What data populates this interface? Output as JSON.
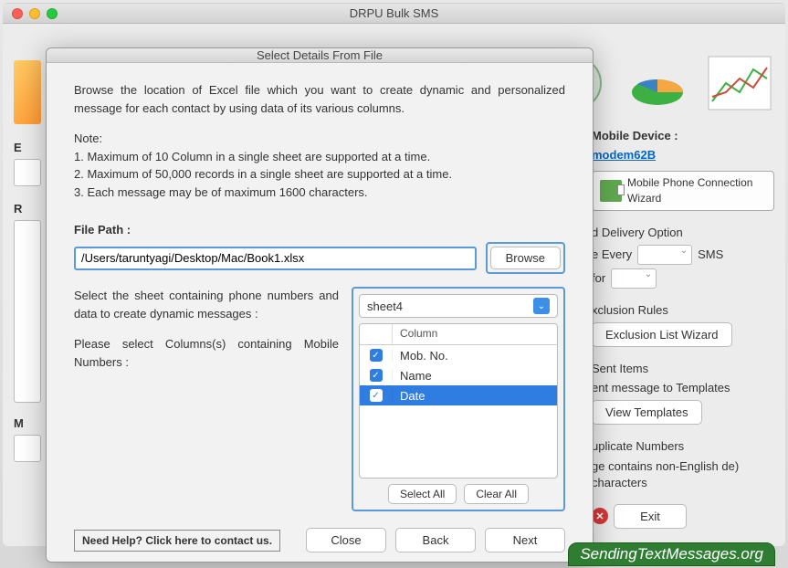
{
  "window": {
    "title": "DRPU Bulk SMS"
  },
  "modal": {
    "title": "Select Details From File",
    "intro": "Browse the location of Excel file which you want to create dynamic and personalized message for each contact by using data of its various columns.",
    "note_label": "Note:",
    "note1": "1. Maximum of 10 Column in a single sheet are supported at a time.",
    "note2": "2. Maximum of 50,000 records in a single sheet are supported at a time.",
    "note3": "3. Each message may be of maximum 1600 characters.",
    "filepath_label": "File Path :",
    "filepath_value": "/Users/taruntyagi/Desktop/Mac/Book1.xlsx",
    "browse": "Browse",
    "sheet_prompt": "Select the sheet containing phone numbers and data to create dynamic messages :",
    "columns_prompt": "Please select Columns(s) containing Mobile Numbers :",
    "selected_sheet": "sheet4",
    "column_header": "Column",
    "columns": [
      {
        "label": "Mob. No.",
        "checked": true,
        "selected": false
      },
      {
        "label": "Name",
        "checked": true,
        "selected": false
      },
      {
        "label": "Date",
        "checked": true,
        "selected": true
      }
    ],
    "select_all": "Select All",
    "clear_all": "Clear All",
    "help": "Need Help? Click here to contact us.",
    "close": "Close",
    "back": "Back",
    "next": "Next"
  },
  "right": {
    "device_label": "Mobile Device :",
    "device_name": "modem62B",
    "wizard": "Mobile Phone Connection  Wizard",
    "delivery_label": "d Delivery Option",
    "every": "e Every",
    "sms": "SMS",
    "for": "for",
    "exclusion_label": "xclusion Rules",
    "exclusion_btn": "Exclusion List Wizard",
    "sent_label": "Sent Items",
    "templates_label": "ent message to Templates",
    "templates_btn": "View Templates",
    "duplicate_label": "uplicate Numbers",
    "unicode_label": "ge contains non-English de) characters",
    "exit": "Exit"
  },
  "bg": {
    "E": "E",
    "R": "R",
    "M": "M"
  },
  "watermark": {
    "text": "SendingTextMessages",
    "suffix": ".org"
  }
}
